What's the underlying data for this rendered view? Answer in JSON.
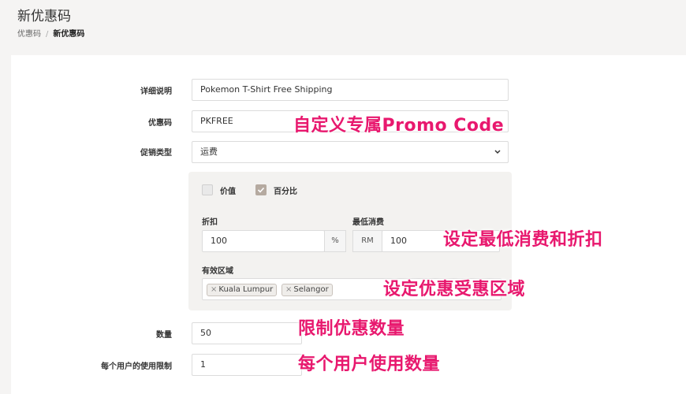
{
  "header": {
    "title": "新优惠码",
    "breadcrumb": {
      "parent": "优惠码",
      "separator": "/",
      "current": "新优惠码"
    }
  },
  "form": {
    "description": {
      "label": "详细说明",
      "value": "Pokemon T-Shirt Free Shipping"
    },
    "code": {
      "label": "优惠码",
      "value": "PKFREE"
    },
    "promo_type": {
      "label": "促销类型",
      "selected": "运费",
      "icon": "chevron-down-icon"
    },
    "discount_panel": {
      "option_value": {
        "label": "价值",
        "checked": false
      },
      "option_percent": {
        "label": "百分比",
        "checked": true
      },
      "discount": {
        "label": "折扣",
        "value": "100",
        "unit": "%"
      },
      "min_spend": {
        "label": "最低消费",
        "currency": "RM",
        "value": "100"
      },
      "zones": {
        "label": "有效区域",
        "tags": [
          "Kuala Lumpur",
          "Selangor"
        ]
      }
    },
    "quantity": {
      "label": "数量",
      "value": "50"
    },
    "per_user_limit": {
      "label": "每个用户的使用限制",
      "value": "1"
    }
  },
  "annotations": {
    "custom_code": "自定义专属Promo Code",
    "min_spend_discount": "设定最低消费和折扣",
    "zones": "设定优惠受惠区域",
    "limit_quantity": "限制优惠数量",
    "per_user": "每个用户使用数量"
  },
  "colors": {
    "accent_annotation": "#e8186e",
    "checkbox_checked": "#b5aaa0"
  }
}
